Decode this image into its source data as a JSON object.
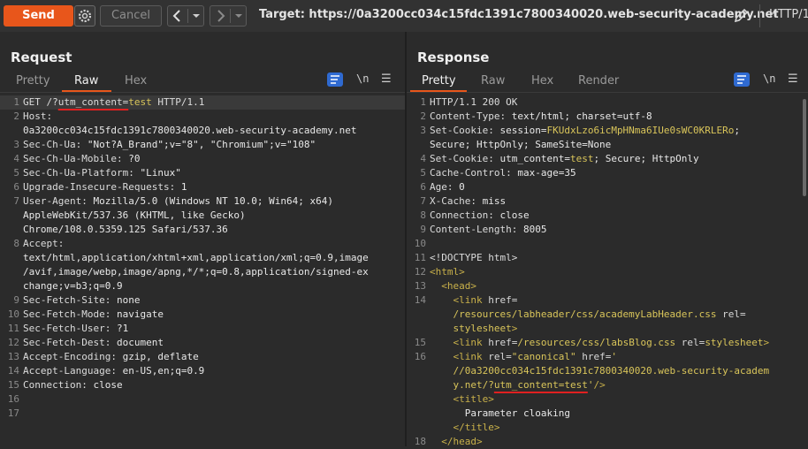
{
  "toolbar": {
    "send_label": "Send",
    "cancel_label": "Cancel",
    "target_text": "Target: https://0a3200cc034c15fdc1391c7800340020.web-security-academy.net",
    "protocol_text": "HTTP/1"
  },
  "request": {
    "title": "Request",
    "tabs": [
      "Pretty",
      "Raw",
      "Hex"
    ],
    "active_tab": "Raw",
    "lines": [
      {
        "n": "1",
        "parts": [
          [
            "k",
            "GET /?"
          ],
          [
            "u",
            "utm_content="
          ],
          [
            "y",
            "test"
          ],
          [
            "k",
            " HTTP/1.1"
          ]
        ]
      },
      {
        "n": "2",
        "parts": [
          [
            "k",
            "Host:"
          ]
        ]
      },
      {
        "n": "",
        "parts": [
          [
            "v",
            "0a3200cc034c15fdc1391c7800340020.web-security-academy.net"
          ]
        ]
      },
      {
        "n": "3",
        "parts": [
          [
            "k",
            "Sec-Ch-Ua: "
          ],
          [
            "v",
            "\"Not?A_Brand\";v=\"8\", \"Chromium\";v=\"108\""
          ]
        ]
      },
      {
        "n": "4",
        "parts": [
          [
            "k",
            "Sec-Ch-Ua-Mobile: "
          ],
          [
            "v",
            "?0"
          ]
        ]
      },
      {
        "n": "5",
        "parts": [
          [
            "k",
            "Sec-Ch-Ua-Platform: "
          ],
          [
            "v",
            "\"Linux\""
          ]
        ]
      },
      {
        "n": "6",
        "parts": [
          [
            "k",
            "Upgrade-Insecure-Requests: "
          ],
          [
            "v",
            "1"
          ]
        ]
      },
      {
        "n": "7",
        "parts": [
          [
            "k",
            "User-Agent: "
          ],
          [
            "v",
            "Mozilla/5.0 (Windows NT 10.0; Win64; x64)"
          ]
        ]
      },
      {
        "n": "",
        "parts": [
          [
            "v",
            "AppleWebKit/537.36 (KHTML, like Gecko)"
          ]
        ]
      },
      {
        "n": "",
        "parts": [
          [
            "v",
            "Chrome/108.0.5359.125 Safari/537.36"
          ]
        ]
      },
      {
        "n": "8",
        "parts": [
          [
            "k",
            "Accept:"
          ]
        ]
      },
      {
        "n": "",
        "parts": [
          [
            "v",
            "text/html,application/xhtml+xml,application/xml;q=0.9,image"
          ]
        ]
      },
      {
        "n": "",
        "parts": [
          [
            "v",
            "/avif,image/webp,image/apng,*/*;q=0.8,application/signed-ex"
          ]
        ]
      },
      {
        "n": "",
        "parts": [
          [
            "v",
            "change;v=b3;q=0.9"
          ]
        ]
      },
      {
        "n": "9",
        "parts": [
          [
            "k",
            "Sec-Fetch-Site: "
          ],
          [
            "v",
            "none"
          ]
        ]
      },
      {
        "n": "10",
        "parts": [
          [
            "k",
            "Sec-Fetch-Mode: "
          ],
          [
            "v",
            "navigate"
          ]
        ]
      },
      {
        "n": "11",
        "parts": [
          [
            "k",
            "Sec-Fetch-User: "
          ],
          [
            "v",
            "?1"
          ]
        ]
      },
      {
        "n": "12",
        "parts": [
          [
            "k",
            "Sec-Fetch-Dest: "
          ],
          [
            "v",
            "document"
          ]
        ]
      },
      {
        "n": "13",
        "parts": [
          [
            "k",
            "Accept-Encoding: "
          ],
          [
            "v",
            "gzip, deflate"
          ]
        ]
      },
      {
        "n": "14",
        "parts": [
          [
            "k",
            "Accept-Language: "
          ],
          [
            "v",
            "en-US,en;q=0.9"
          ]
        ]
      },
      {
        "n": "15",
        "parts": [
          [
            "k",
            "Connection: "
          ],
          [
            "v",
            "close"
          ]
        ]
      },
      {
        "n": "16",
        "parts": []
      },
      {
        "n": "17",
        "parts": []
      }
    ]
  },
  "response": {
    "title": "Response",
    "tabs": [
      "Pretty",
      "Raw",
      "Hex",
      "Render"
    ],
    "active_tab": "Pretty",
    "lines": [
      {
        "n": "1",
        "parts": [
          [
            "k",
            "HTTP/1.1 200 OK"
          ]
        ]
      },
      {
        "n": "2",
        "parts": [
          [
            "k",
            "Content-Type: "
          ],
          [
            "v",
            "text/html; charset=utf-8"
          ]
        ]
      },
      {
        "n": "3",
        "parts": [
          [
            "k",
            "Set-Cookie: "
          ],
          [
            "v",
            "session="
          ],
          [
            "y",
            "FKUdxLzo6icMpHNma6IUe0sWC0KRLERo"
          ],
          [
            "v",
            ";"
          ]
        ]
      },
      {
        "n": "",
        "parts": [
          [
            "v",
            "Secure; HttpOnly; SameSite=None"
          ]
        ]
      },
      {
        "n": "4",
        "parts": [
          [
            "k",
            "Set-Cookie: "
          ],
          [
            "v",
            "utm_content="
          ],
          [
            "y",
            "test"
          ],
          [
            "v",
            "; Secure; HttpOnly"
          ]
        ]
      },
      {
        "n": "5",
        "parts": [
          [
            "k",
            "Cache-Control: "
          ],
          [
            "v",
            "max-age=35"
          ]
        ]
      },
      {
        "n": "6",
        "parts": [
          [
            "k",
            "Age: "
          ],
          [
            "v",
            "0"
          ]
        ]
      },
      {
        "n": "7",
        "parts": [
          [
            "k",
            "X-Cache: "
          ],
          [
            "v",
            "miss"
          ]
        ]
      },
      {
        "n": "8",
        "parts": [
          [
            "k",
            "Connection: "
          ],
          [
            "v",
            "close"
          ]
        ]
      },
      {
        "n": "9",
        "parts": [
          [
            "k",
            "Content-Length: "
          ],
          [
            "v",
            "8005"
          ]
        ]
      },
      {
        "n": "10",
        "parts": []
      },
      {
        "n": "11",
        "parts": [
          [
            "k",
            "<!DOCTYPE html>"
          ]
        ]
      },
      {
        "n": "12",
        "parts": [
          [
            "t",
            "<html>"
          ]
        ]
      },
      {
        "n": "13",
        "parts": [
          [
            "k",
            "  "
          ],
          [
            "t",
            "<head>"
          ]
        ]
      },
      {
        "n": "14",
        "parts": [
          [
            "k",
            "    "
          ],
          [
            "t",
            "<link "
          ],
          [
            "at",
            "href="
          ]
        ]
      },
      {
        "n": "",
        "parts": [
          [
            "y",
            "    /resources/labheader/css/academyLabHeader.css"
          ],
          [
            "at",
            " rel="
          ]
        ]
      },
      {
        "n": "",
        "parts": [
          [
            "y",
            "    stylesheet"
          ],
          [
            "t",
            ">"
          ]
        ]
      },
      {
        "n": "15",
        "parts": [
          [
            "k",
            "    "
          ],
          [
            "t",
            "<link "
          ],
          [
            "at",
            "href="
          ],
          [
            "y",
            "/resources/css/labsBlog.css"
          ],
          [
            "at",
            " rel="
          ],
          [
            "y",
            "stylesheet"
          ],
          [
            "t",
            ">"
          ]
        ]
      },
      {
        "n": "16",
        "parts": [
          [
            "k",
            "    "
          ],
          [
            "t",
            "<link "
          ],
          [
            "at",
            "rel="
          ],
          [
            "y",
            "\"canonical\""
          ],
          [
            "at",
            " href="
          ],
          [
            "y",
            "'"
          ]
        ]
      },
      {
        "n": "",
        "parts": [
          [
            "y",
            "    //0a3200cc034c15fdc1391c7800340020.web-security-academ"
          ]
        ]
      },
      {
        "n": "",
        "parts": [
          [
            "y",
            "    y.net/?"
          ],
          [
            "uy",
            "utm_content=test"
          ],
          [
            "y",
            "'"
          ],
          [
            "t",
            "/>"
          ]
        ]
      },
      {
        "n": "",
        "parts": [
          [
            "k",
            "    "
          ],
          [
            "t",
            "<title>"
          ]
        ]
      },
      {
        "n": "",
        "parts": [
          [
            "v",
            "      Parameter cloaking"
          ]
        ]
      },
      {
        "n": "",
        "parts": [
          [
            "k",
            "    "
          ],
          [
            "t",
            "</title>"
          ]
        ]
      },
      {
        "n": "18",
        "parts": [
          [
            "k",
            "  "
          ],
          [
            "t",
            "</head>"
          ]
        ]
      }
    ]
  }
}
